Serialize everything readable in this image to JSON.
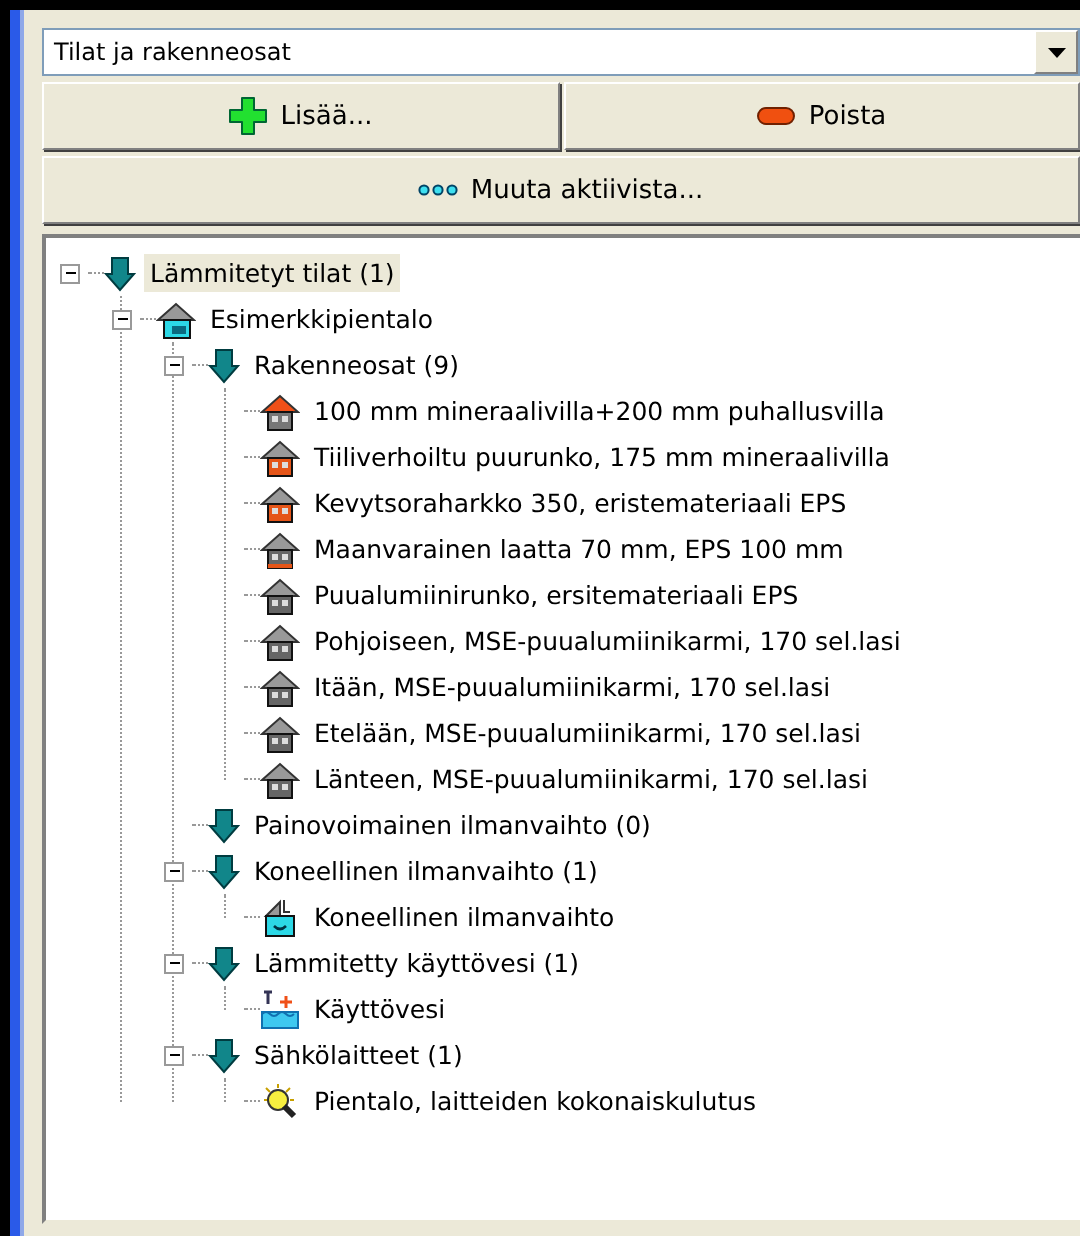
{
  "view_select": {
    "value": "Tilat ja rakenneosat"
  },
  "buttons": [
    {
      "kind": "add",
      "label": "Lisää..."
    },
    {
      "kind": "remove",
      "label": "Poista"
    },
    {
      "kind": "edit",
      "label": "Muuta aktiivista..."
    }
  ],
  "tree": [
    {
      "label": "Lämmitetyt tilat (1)",
      "kind": "arrow",
      "selected": true,
      "expanded": true,
      "children": [
        {
          "label": "Esimerkkipientalo",
          "kind": "house-space",
          "selected": false,
          "expanded": true,
          "children": [
            {
              "label": "Rakenneosat (9)",
              "kind": "arrow",
              "selected": false,
              "expanded": true,
              "children": [
                {
                  "label": "100 mm mineraalivilla+200 mm puhallusvilla",
                  "kind": "house-roof",
                  "selected": false
                },
                {
                  "label": "Tiiliverhoiltu puurunko, 175 mm mineraalivilla",
                  "kind": "house-wall",
                  "selected": false
                },
                {
                  "label": "Kevytsoraharkko 350, eristemateriaali EPS",
                  "kind": "house-wall",
                  "selected": false
                },
                {
                  "label": "Maanvarainen laatta 70 mm, EPS 100 mm",
                  "kind": "house-floor",
                  "selected": false
                },
                {
                  "label": "Puualumiinirunko, ersitemateriaali EPS",
                  "kind": "house-window",
                  "selected": false
                },
                {
                  "label": "Pohjoiseen, MSE-puualumiinikarmi, 170 sel.lasi",
                  "kind": "house-window",
                  "selected": false
                },
                {
                  "label": "Itään, MSE-puualumiinikarmi, 170 sel.lasi",
                  "kind": "house-window",
                  "selected": false
                },
                {
                  "label": "Etelään, MSE-puualumiinikarmi, 170 sel.lasi",
                  "kind": "house-window",
                  "selected": false
                },
                {
                  "label": "Länteen, MSE-puualumiinikarmi, 170 sel.lasi",
                  "kind": "house-window",
                  "selected": false
                }
              ]
            },
            {
              "label": "Painovoimainen ilmanvaihto (0)",
              "kind": "arrow",
              "selected": false
            },
            {
              "label": "Koneellinen ilmanvaihto (1)",
              "kind": "arrow",
              "selected": false,
              "expanded": true,
              "children": [
                {
                  "label": "Koneellinen ilmanvaihto",
                  "kind": "ventilation",
                  "selected": false
                }
              ]
            },
            {
              "label": "Lämmitetty käyttövesi (1)",
              "kind": "arrow",
              "selected": false,
              "expanded": true,
              "children": [
                {
                  "label": "Käyttövesi",
                  "kind": "water",
                  "selected": false
                }
              ]
            },
            {
              "label": "Sähkölaitteet (1)",
              "kind": "arrow",
              "selected": false,
              "expanded": true,
              "children": [
                {
                  "label": "Pientalo, laitteiden kokonaiskulutus",
                  "kind": "bulb",
                  "selected": false
                }
              ]
            }
          ]
        }
      ]
    }
  ]
}
